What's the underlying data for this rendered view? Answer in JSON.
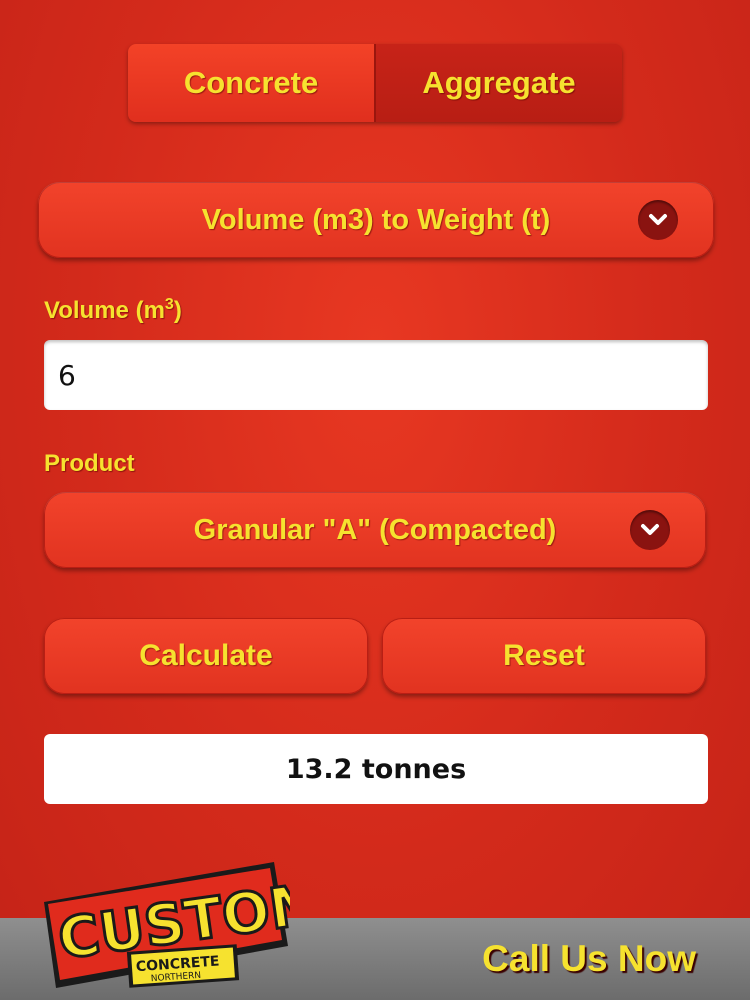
{
  "tabs": [
    {
      "label": "Concrete",
      "active": true
    },
    {
      "label": "Aggregate",
      "active": false
    }
  ],
  "conversion": {
    "selected": "Volume (m3) to Weight (t)"
  },
  "volume": {
    "label": "Volume (m",
    "label_sup": "3",
    "label_suffix": ")",
    "value": "6"
  },
  "product": {
    "label": "Product",
    "selected": "Granular \"A\" (Compacted)"
  },
  "buttons": {
    "calculate": "Calculate",
    "reset": "Reset"
  },
  "result": {
    "text": "13.2 tonnes"
  },
  "logo": {
    "brand": "CUSTOM",
    "line1": "CONCRETE",
    "line2": "NORTHERN"
  },
  "footer": {
    "call_label": "Call Us Now"
  },
  "colors": {
    "background": "#d32a1b",
    "text": "#f6e22f",
    "footer": "#7d7d7d"
  },
  "icons": {
    "dropdown": "chevron-down-icon"
  }
}
